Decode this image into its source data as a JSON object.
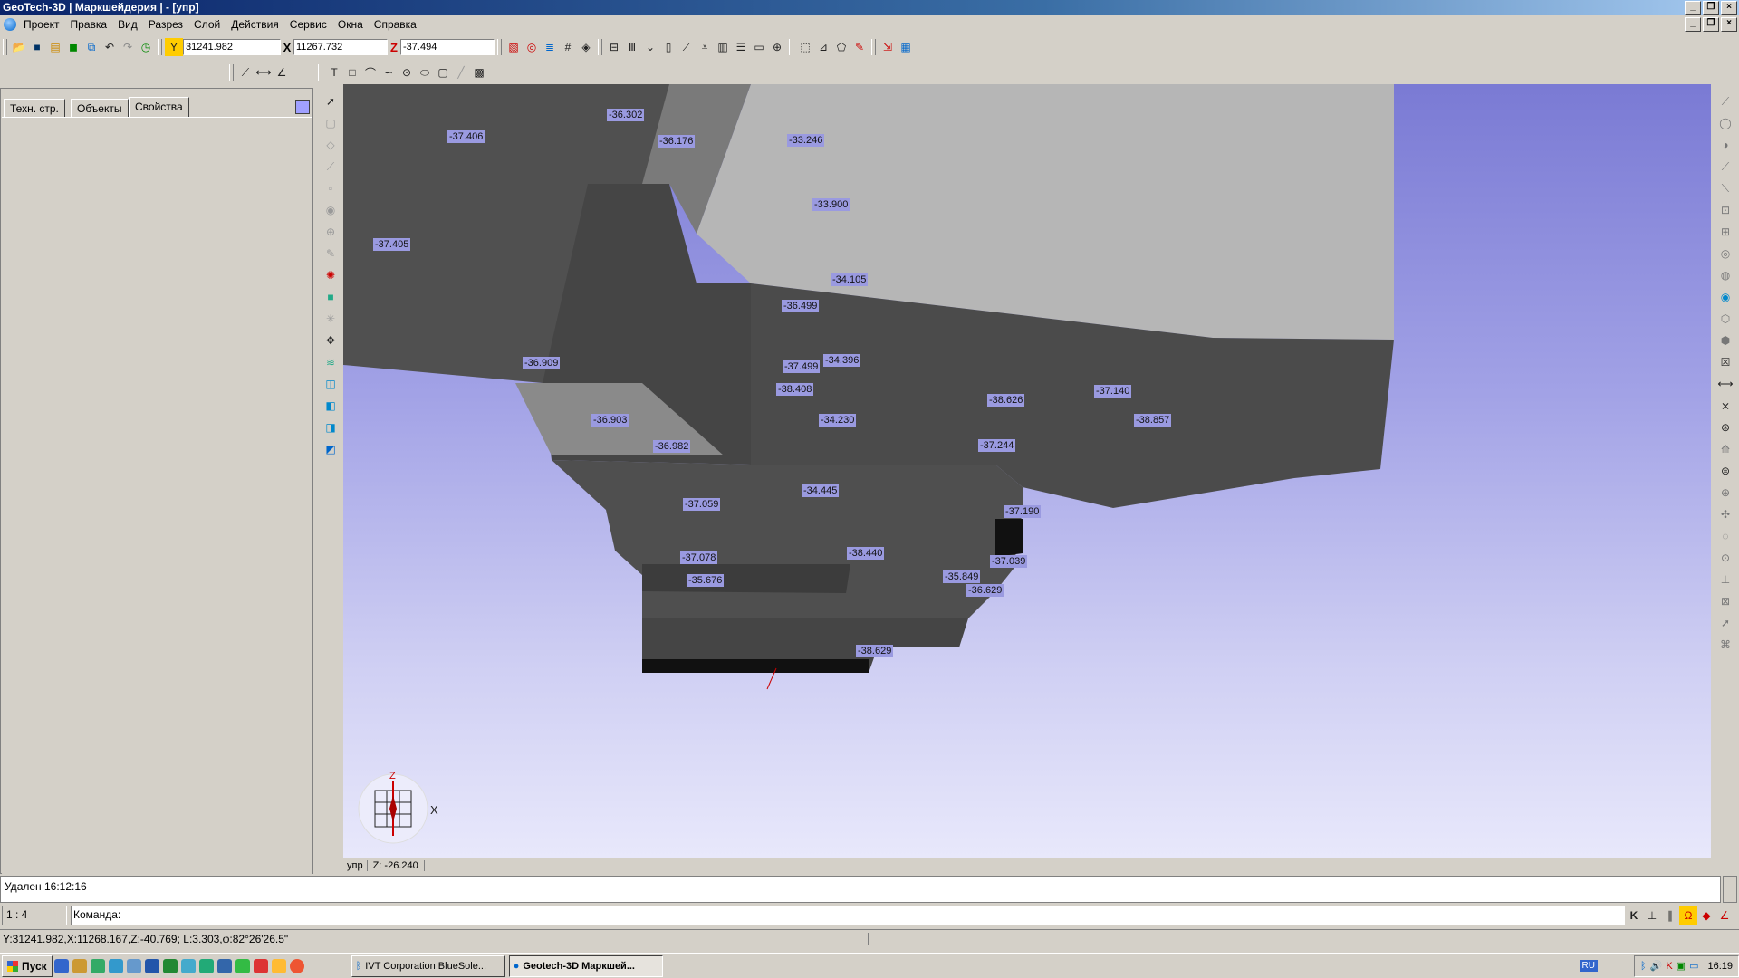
{
  "window": {
    "title": "GeoTech-3D | Маркшейдерия | - [упр]"
  },
  "menu": [
    "Проект",
    "Правка",
    "Вид",
    "Разрез",
    "Слой",
    "Действия",
    "Сервис",
    "Окна",
    "Справка"
  ],
  "coords": {
    "y_label": "Y",
    "y_value": "31241.982",
    "x_label": "X",
    "x_value": "11267.732",
    "z_label": "Z",
    "z_value": "-37.494"
  },
  "panel": {
    "tabs": [
      "Техн. стр.",
      "Объекты",
      "Свойства"
    ],
    "active_tab": "Свойства"
  },
  "viewport": {
    "labels": [
      "-36.302",
      "-37.406",
      "-36.176",
      "-33.246",
      "-33.900",
      "-37.405",
      "-34.105",
      "-36.499",
      "-36.909",
      "-37.499",
      "-34.396",
      "-38.408",
      "-36.903",
      "-34.230",
      "-38.626",
      "-37.140",
      "-38.857",
      "-36.982",
      "-37.244",
      "-34.445",
      "-37.059",
      "-37.190",
      "-37.078",
      "-38.440",
      "-37.039",
      "-35.676",
      "-35.849",
      "-36.629",
      "-38.629"
    ],
    "axis_z": "Z",
    "axis_x": "X"
  },
  "view_status": {
    "tab": "упр",
    "z_text": "Z: -26.240"
  },
  "messages": {
    "line1": "Удален 16:12:16"
  },
  "command": {
    "scale": "1 : 4",
    "prompt": "Команда:"
  },
  "status": {
    "coords": "Y:31241.982,X:11268.167,Z:-40.769; L:3.303,φ:82°26'26.5\""
  },
  "taskbar": {
    "start": "Пуск",
    "tasks": [
      "IVT Corporation BlueSole...",
      "Geotech-3D Маркшей..."
    ],
    "lang": "RU",
    "time": "16:19"
  }
}
